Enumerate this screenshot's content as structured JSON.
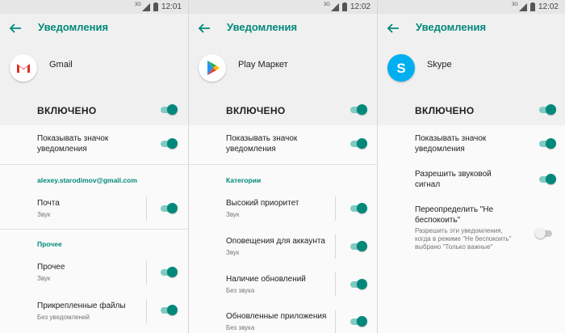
{
  "colors": {
    "accent": "#00897b",
    "accent_light": "#80cbc4"
  },
  "panels": [
    {
      "status": {
        "network": "3G",
        "time": "12:01"
      },
      "toolbar": {
        "title": "Уведомления"
      },
      "app": {
        "name": "Gmail",
        "icon": "gmail-icon"
      },
      "master": {
        "label": "ВКЛЮЧЕНО",
        "on": true
      },
      "badge": {
        "label": "Показывать значок уведомления",
        "on": true
      },
      "sections": [
        {
          "title": "alexey.starodimov@gmail.com",
          "items": [
            {
              "label": "Почта",
              "sub": "Звук",
              "on": true
            }
          ]
        },
        {
          "title": "Прочее",
          "items": [
            {
              "label": "Прочее",
              "sub": "Звук",
              "on": true
            },
            {
              "label": "Прикрепленные файлы",
              "sub": "Без уведомлений",
              "on": true
            }
          ]
        }
      ]
    },
    {
      "status": {
        "network": "3G",
        "time": "12:02"
      },
      "toolbar": {
        "title": "Уведомления"
      },
      "app": {
        "name": "Play Маркет",
        "icon": "play-market-icon"
      },
      "master": {
        "label": "ВКЛЮЧЕНО",
        "on": true
      },
      "badge": {
        "label": "Показывать значок уведомления",
        "on": true
      },
      "sections": [
        {
          "title": "Категории",
          "items": [
            {
              "label": "Высокий приоритет",
              "sub": "Звук",
              "on": true
            },
            {
              "label": "Оповещения для аккаунта",
              "sub": "Звук",
              "on": true
            },
            {
              "label": "Наличие обновлений",
              "sub": "Без звука",
              "on": true
            },
            {
              "label": "Обновленные приложения",
              "sub": "Без звука",
              "on": true
            }
          ]
        }
      ]
    },
    {
      "status": {
        "network": "3G",
        "time": "12:02"
      },
      "toolbar": {
        "title": "Уведомления"
      },
      "app": {
        "name": "Skype",
        "icon": "skype-icon"
      },
      "master": {
        "label": "ВКЛЮЧЕНО",
        "on": true
      },
      "badge": {
        "label": "Показывать значок уведомления",
        "on": true
      },
      "sound": {
        "label": "Разрешить звуковой сигнал",
        "on": true
      },
      "dnd": {
        "label": "Переопределить \"Не беспокоить\"",
        "sub": "Разрешить эти уведомления, когда в режиме \"Не беспокоить\" выбрано \"Только важные\"",
        "on": false
      }
    }
  ]
}
